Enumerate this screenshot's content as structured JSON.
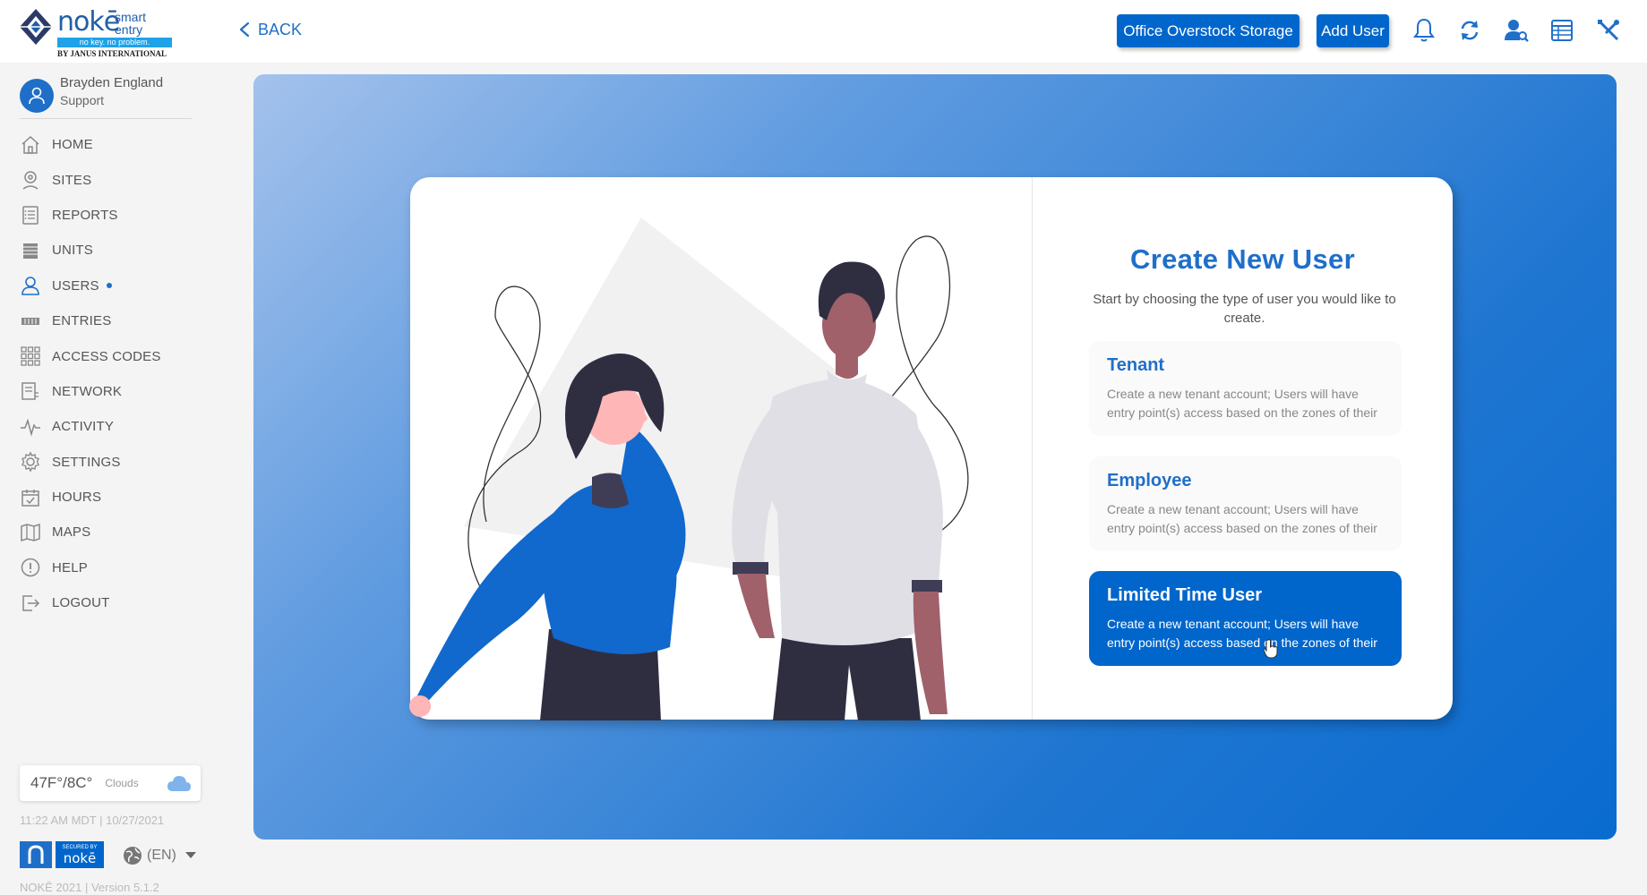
{
  "header": {
    "logo": {
      "brand": "nokē",
      "brand_sub": "smart entry",
      "tagline": "no key. no problem.",
      "byline": "BY JANUS INTERNATIONAL"
    },
    "back_label": "BACK",
    "site_button": "Office Overstock Storage",
    "add_user_button": "Add User",
    "icons": [
      "bell-icon",
      "refresh-icon",
      "user-search-icon",
      "table-list-icon",
      "tools-icon"
    ]
  },
  "sidebar": {
    "user_name": "Brayden England",
    "user_role": "Support",
    "items": [
      {
        "label": "HOME",
        "icon": "home-icon"
      },
      {
        "label": "SITES",
        "icon": "location-pin-icon"
      },
      {
        "label": "REPORTS",
        "icon": "clipboard-list-icon"
      },
      {
        "label": "UNITS",
        "icon": "units-icon"
      },
      {
        "label": "USERS",
        "icon": "user-icon",
        "active": true
      },
      {
        "label": "ENTRIES",
        "icon": "entries-icon"
      },
      {
        "label": "ACCESS CODES",
        "icon": "keypad-grid-icon"
      },
      {
        "label": "NETWORK",
        "icon": "network-doc-icon"
      },
      {
        "label": "ACTIVITY",
        "icon": "activity-pulse-icon"
      },
      {
        "label": "SETTINGS",
        "icon": "gear-icon"
      },
      {
        "label": "HOURS",
        "icon": "calendar-check-icon"
      },
      {
        "label": "MAPS",
        "icon": "map-icon"
      },
      {
        "label": "HELP",
        "icon": "help-icon"
      },
      {
        "label": "LOGOUT",
        "icon": "logout-icon"
      }
    ],
    "weather": {
      "temp": "47F°/8C°",
      "condition": "Clouds",
      "icon": "cloud-icon"
    },
    "datetime": "11:22 AM MDT | 10/27/2021",
    "badge_secured_small": "SECURED BY",
    "badge_secured_brand": "nokē",
    "language": "(EN)",
    "version": "NOKĒ 2021 | Version 5.1.2"
  },
  "main": {
    "title": "Create New User",
    "subtitle": "Start by choosing the type of user you would like to create.",
    "options": [
      {
        "title": "Tenant",
        "description": "Create a new tenant account; Users will have entry point(s) access based on the zones of their",
        "selected": false
      },
      {
        "title": "Employee",
        "description": "Create a new tenant account; Users will have entry point(s) access based on the zones of their",
        "selected": false
      },
      {
        "title": "Limited Time User",
        "description": "Create a new tenant account; Users will have entry point(s) access based on the zones of their",
        "selected": true
      }
    ]
  },
  "colors": {
    "accent": "#0066cc",
    "accent_text": "#1f6fc9",
    "sidebar_text": "#555555"
  }
}
